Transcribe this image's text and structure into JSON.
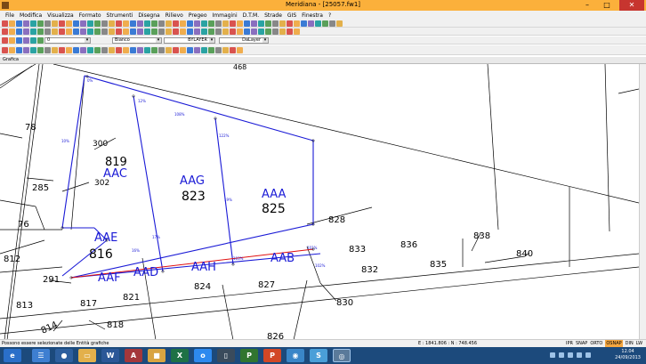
{
  "window": {
    "title": "Meridiana - [25057.fw1]",
    "minimize": "–",
    "maximize": "□",
    "close": "✕"
  },
  "menu": [
    "File",
    "Modifica",
    "Visualizza",
    "Formato",
    "Strumenti",
    "Disegna",
    "Rilievo",
    "Pregeo",
    "Immagini",
    "D.T.M.",
    "Strade",
    "GIS",
    "Finestra",
    "?"
  ],
  "toolbar": {
    "layer_value": "0",
    "color_value": "Bianco",
    "linetype_value": "BYLAYER",
    "lineweight_value": "DaLayer"
  },
  "panel_label": "Grafica",
  "drawing": {
    "parcels_black": [
      "819",
      "823",
      "825",
      "816",
      "828",
      "833",
      "836",
      "838",
      "840",
      "832",
      "835",
      "824",
      "827",
      "821",
      "830",
      "812",
      "813",
      "814",
      "817",
      "818",
      "826",
      "78",
      "285",
      "76",
      "291",
      "300",
      "302",
      "468"
    ],
    "labels_blue": [
      "AAC",
      "AAG",
      "AAA",
      "AAE",
      "AAD",
      "AAF",
      "AAH",
      "AAB"
    ],
    "dims_blue": [
      "0%",
      "10%",
      "12%",
      "16%",
      "17%",
      "19%",
      "101%",
      "102%",
      "103%",
      "108%",
      "122%"
    ]
  },
  "status": {
    "message": "Possono essere selezionate delle Entità grafiche",
    "coords": "E : 1841.806 : N : 748.456",
    "modes": [
      "IPR",
      "SNAP",
      "ORTO",
      "OSNAP",
      "DIN",
      "LW"
    ],
    "active_mode": "OSNAP"
  },
  "taskbar": {
    "apps": [
      "ie-icon",
      "explorer-icon",
      "outlook-icon",
      "folder-icon",
      "word-icon",
      "access-icon",
      "app-icon",
      "excel-icon",
      "onenote-icon",
      "usb-icon",
      "project-icon",
      "powerpoint-icon",
      "chrome-icon",
      "skype-icon",
      "meridiana-icon"
    ],
    "time": "12.04",
    "date": "24/09/2013"
  }
}
